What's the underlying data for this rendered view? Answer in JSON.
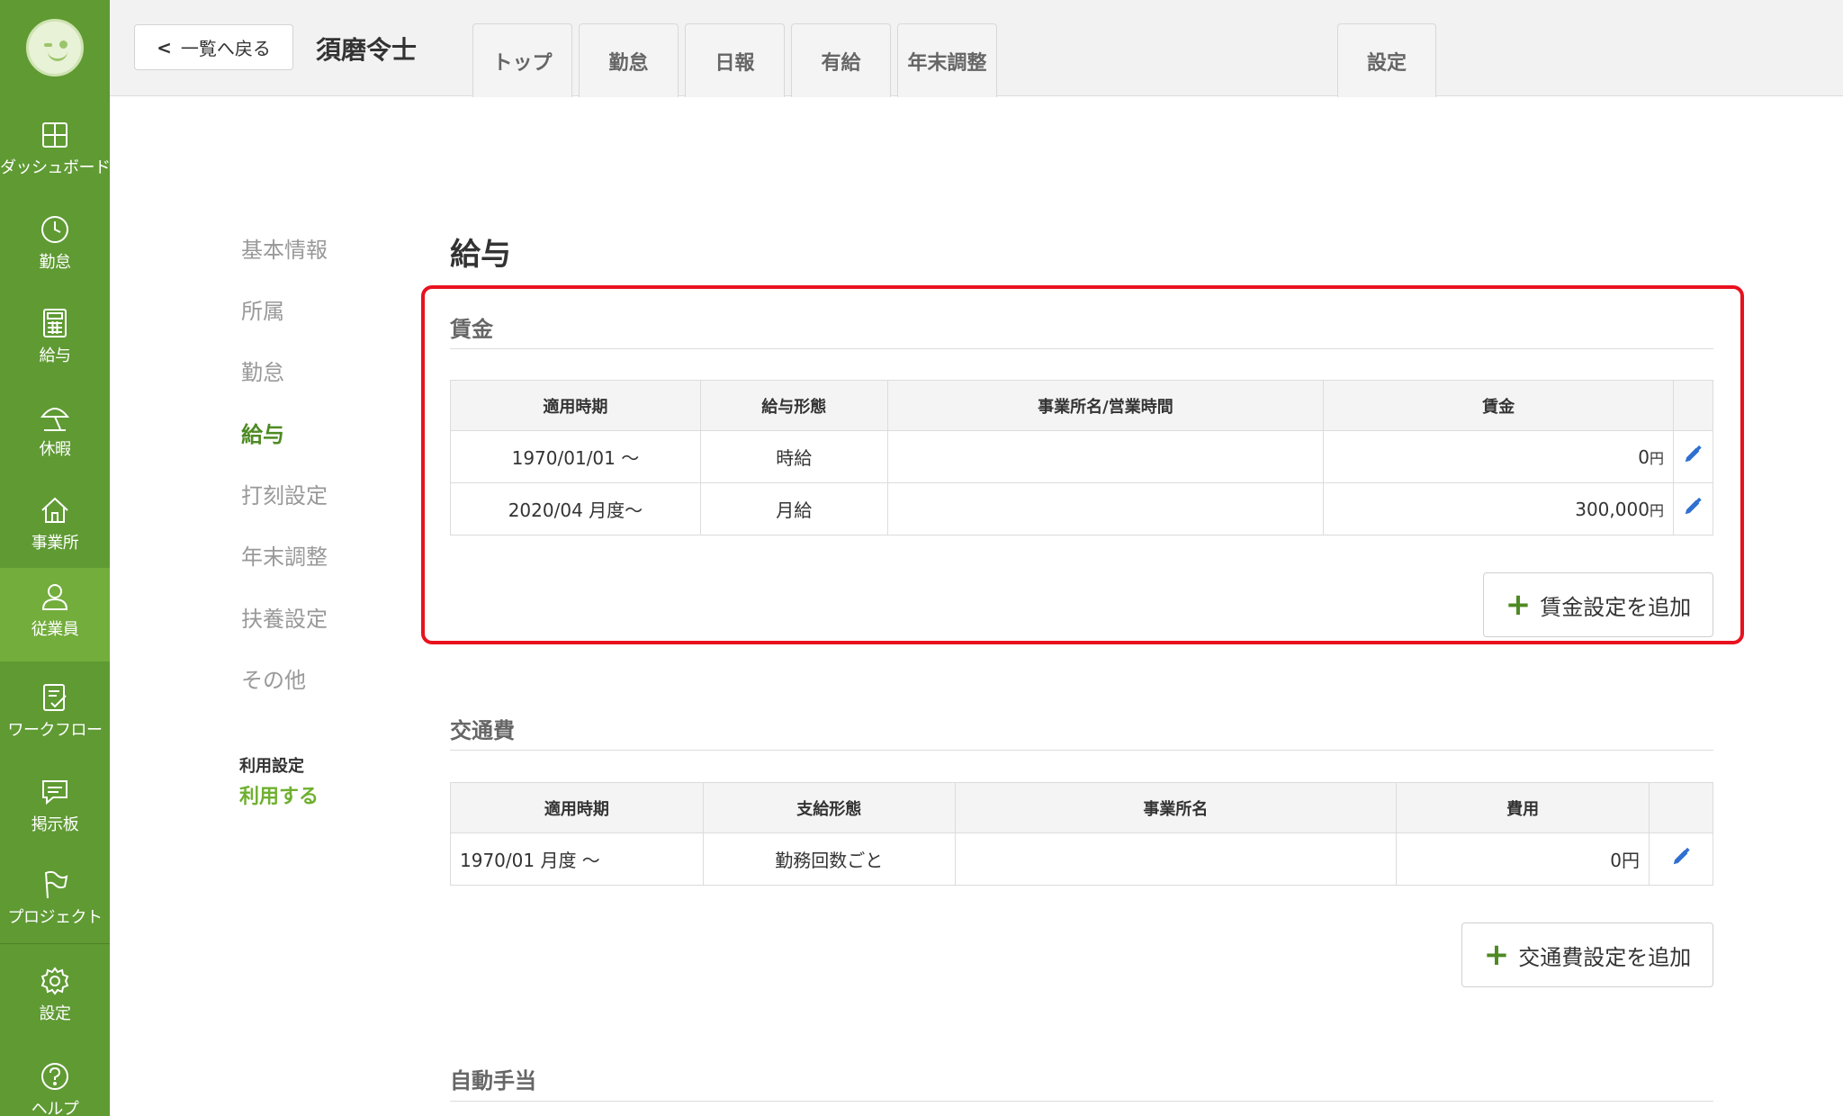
{
  "sidebar": {
    "items": [
      {
        "label": "ダッシュボード",
        "icon": "dashboard-icon"
      },
      {
        "label": "勤怠",
        "icon": "clock-icon"
      },
      {
        "label": "給与",
        "icon": "calculator-icon"
      },
      {
        "label": "休暇",
        "icon": "parasol-icon"
      },
      {
        "label": "事業所",
        "icon": "home-icon"
      },
      {
        "label": "従業員",
        "icon": "person-icon"
      },
      {
        "label": "ワークフロー",
        "icon": "checklist-icon"
      },
      {
        "label": "掲示板",
        "icon": "chat-icon"
      },
      {
        "label": "プロジェクト",
        "icon": "flag-icon"
      },
      {
        "label": "設定",
        "icon": "gear-icon"
      },
      {
        "label": "ヘルプ",
        "icon": "help-icon"
      }
    ],
    "active": "従業員"
  },
  "header": {
    "back_label": "一覧へ戻る",
    "employee_name": "須磨令士",
    "tabs": [
      {
        "label": "トップ"
      },
      {
        "label": "勤怠"
      },
      {
        "label": "日報"
      },
      {
        "label": "有給"
      },
      {
        "label": "年末調整"
      }
    ],
    "settings_tab": "設定"
  },
  "submenu": {
    "items": [
      {
        "label": "基本情報"
      },
      {
        "label": "所属"
      },
      {
        "label": "勤怠"
      },
      {
        "label": "給与"
      },
      {
        "label": "打刻設定"
      },
      {
        "label": "年末調整"
      },
      {
        "label": "扶養設定"
      },
      {
        "label": "その他"
      }
    ],
    "active": "給与",
    "usage_label": "利用設定",
    "usage_value": "利用する"
  },
  "main": {
    "title": "給与",
    "wage": {
      "section_title": "賃金",
      "headers": [
        "適用時期",
        "給与形態",
        "事業所名/営業時間",
        "賃金"
      ],
      "rows": [
        {
          "period": "1970/01/01 〜",
          "type": "時給",
          "office": "",
          "amount": "0",
          "unit": "円"
        },
        {
          "period": "2020/04 月度〜",
          "type": "月給",
          "office": "",
          "amount": "300,000",
          "unit": "円"
        }
      ],
      "add_label": "賃金設定を追加"
    },
    "commute": {
      "section_title": "交通費",
      "headers": [
        "適用時期",
        "支給形態",
        "事業所名",
        "費用"
      ],
      "rows": [
        {
          "period": "1970/01 月度 〜",
          "type": "勤務回数ごと",
          "office": "",
          "amount": "0円"
        }
      ],
      "add_label": "交通費設定を追加"
    },
    "allowance": {
      "section_title": "自動手当"
    }
  },
  "colors": {
    "sidebar_bg": "#5f9a33",
    "accent_green": "#4e8a23",
    "highlight_red": "#e8121e",
    "edit_blue": "#2f6fd1"
  }
}
